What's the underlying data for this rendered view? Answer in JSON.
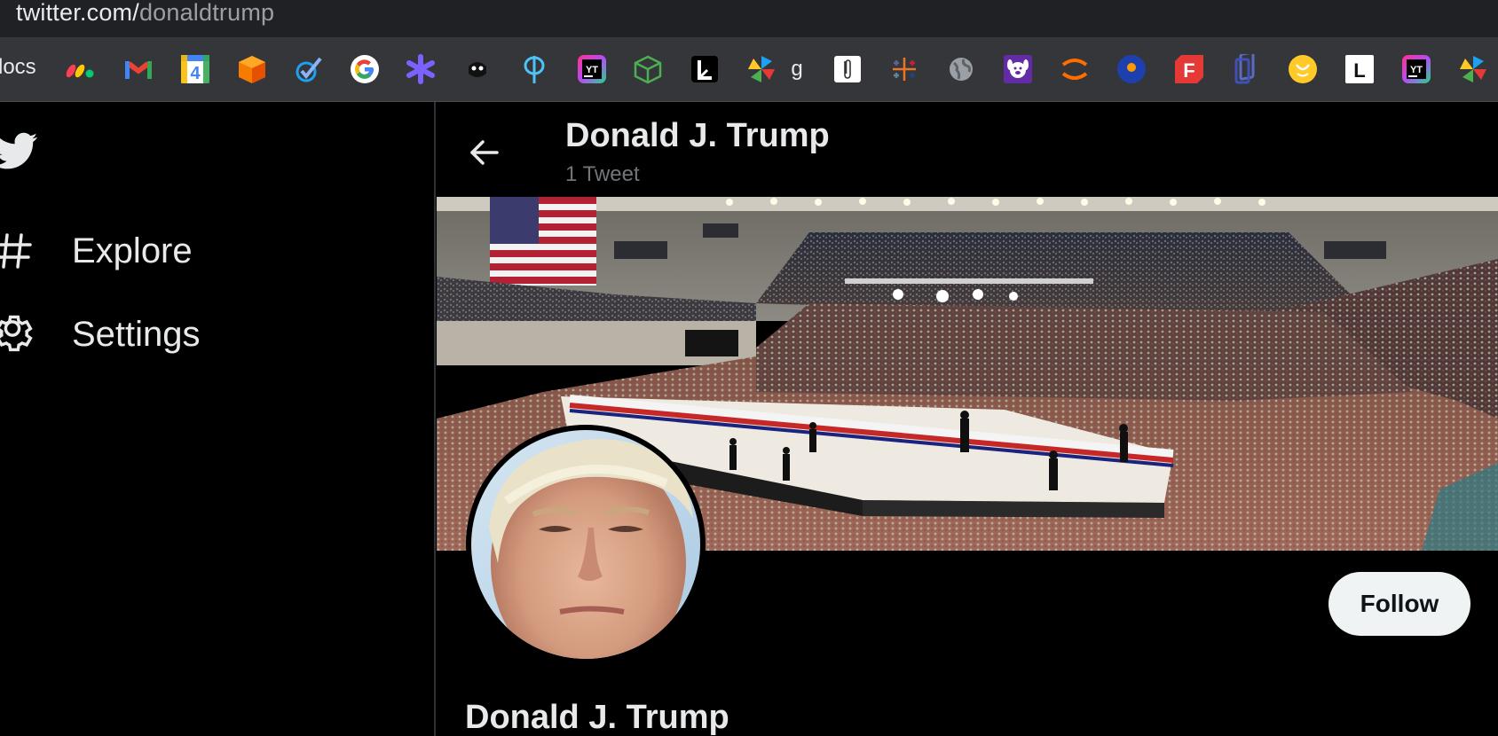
{
  "browser": {
    "url_host": "twitter.com/",
    "url_path": "donaldtrump",
    "bookmarks": {
      "first_label": "locs",
      "items": [
        {
          "icon": "monday-icon",
          "color": "#ff3d57"
        },
        {
          "icon": "gmail-icon",
          "color": "#ea4335"
        },
        {
          "icon": "google-calendar-icon",
          "text": "4",
          "color": "#4285f4"
        },
        {
          "icon": "orange-cube-icon",
          "color": "#f57c00"
        },
        {
          "icon": "checkmark-icon",
          "color": "#1da1f2"
        },
        {
          "icon": "google-icon",
          "text": "G",
          "color": "#4285f4"
        },
        {
          "icon": "purple-star-icon",
          "color": "#7b61ff"
        },
        {
          "icon": "spy-icon",
          "color": "#ffffff"
        },
        {
          "icon": "phi-icon",
          "color": "#4fc3f7"
        },
        {
          "icon": "yt-app-icon",
          "text": "YT",
          "color": "#c05cff"
        },
        {
          "icon": "cube-outline-icon",
          "color": "#4caf50"
        },
        {
          "icon": "l-app-icon",
          "color": "#ffffff"
        },
        {
          "icon": "pinwheel-icon",
          "color": "#1da1f2"
        },
        {
          "icon": "g-text-icon",
          "text": "g",
          "color": "#e8eaed"
        },
        {
          "icon": "paperclip-icon",
          "color": "#ffffff"
        },
        {
          "icon": "tableau-icon",
          "color": "#e97627"
        },
        {
          "icon": "globe-icon",
          "color": "#9aa0a6"
        },
        {
          "icon": "dog-icon",
          "color": "#7e57c2"
        },
        {
          "icon": "arc-icon",
          "color": "#ff6d00"
        },
        {
          "icon": "dot-circle-icon",
          "color": "#1e40af"
        },
        {
          "icon": "f-app-icon",
          "text": "F",
          "color": "#e53935"
        },
        {
          "icon": "layers-icon",
          "color": "#3f51b5"
        },
        {
          "icon": "smiley-icon",
          "color": "#ffca28"
        },
        {
          "icon": "l-square-icon",
          "text": "L",
          "color": "#ffffff"
        },
        {
          "icon": "yt-app-icon-2",
          "text": "YT",
          "color": "#c05cff"
        },
        {
          "icon": "pinwheel-icon-2",
          "color": "#1da1f2"
        }
      ]
    }
  },
  "sidebar": {
    "logo": "twitter-bird-icon",
    "items": [
      {
        "label": "Explore",
        "icon": "hashtag-icon"
      },
      {
        "label": "Settings",
        "icon": "gear-icon"
      }
    ]
  },
  "header": {
    "name": "Donald J. Trump",
    "tweet_count": "1 Tweet"
  },
  "profile": {
    "name": "Donald J. Trump",
    "follow_label": "Follow"
  },
  "colors": {
    "background": "#000000",
    "text": "#e7e9ea",
    "muted": "#71767b",
    "follow_bg": "#eff3f4"
  }
}
